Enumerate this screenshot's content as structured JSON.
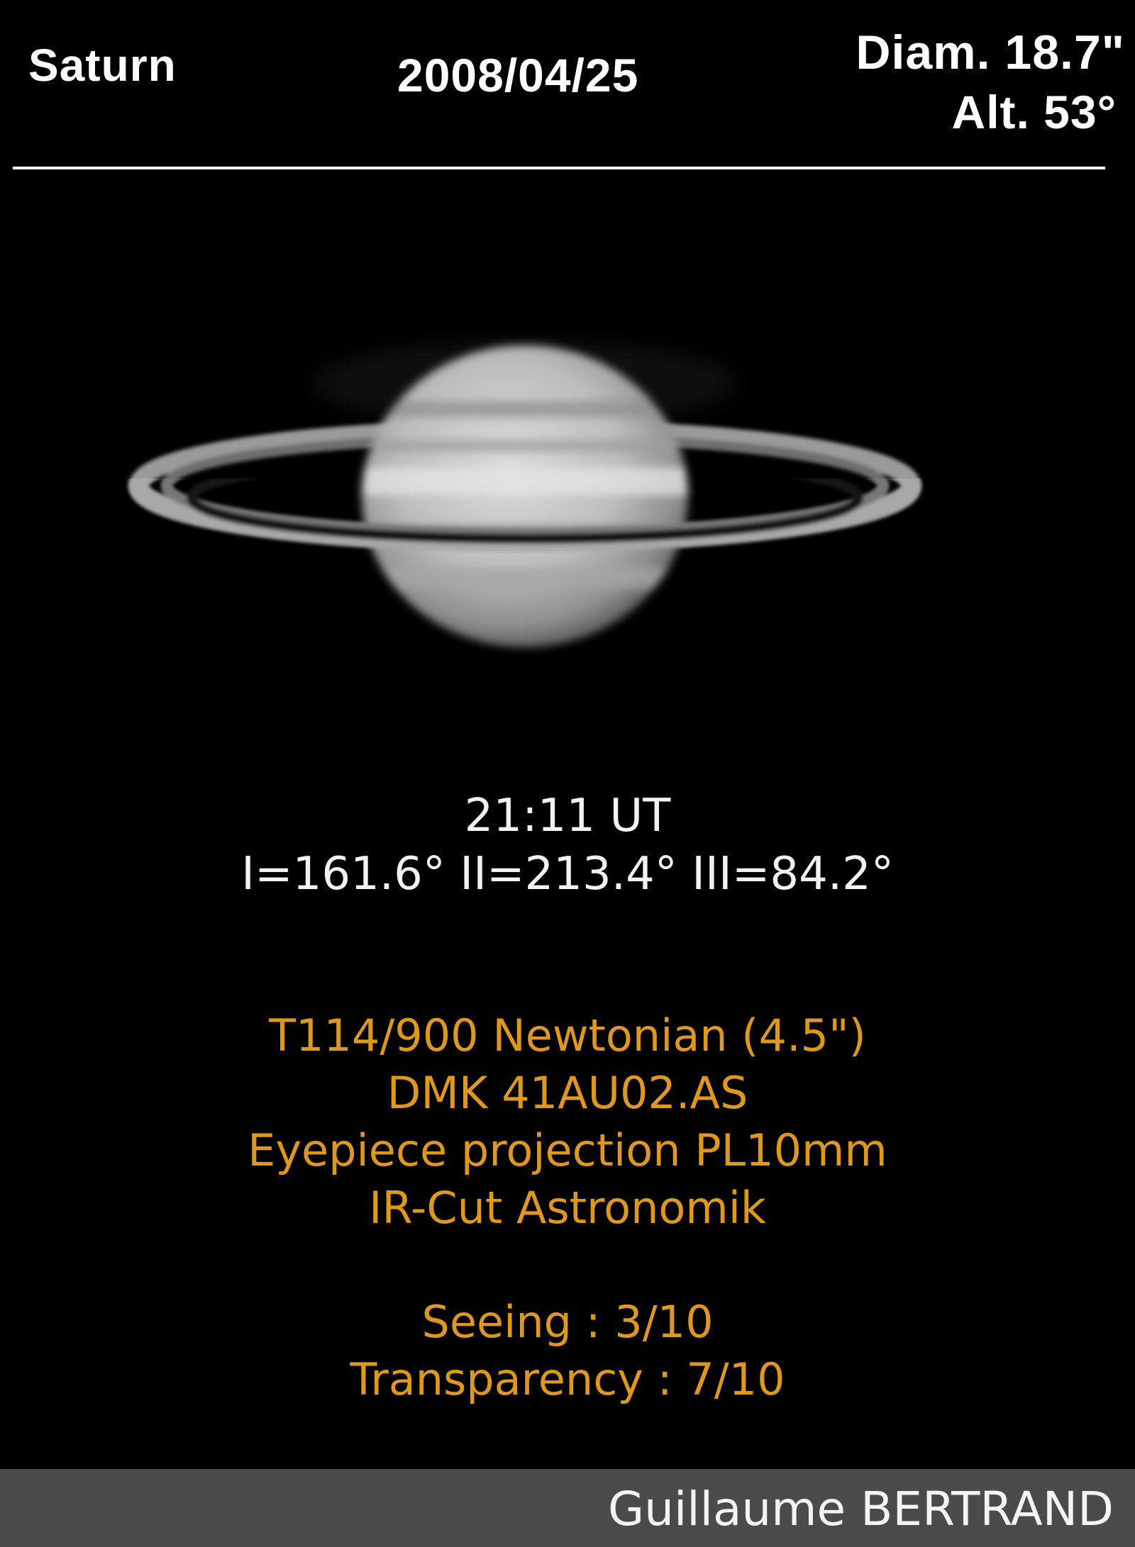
{
  "header": {
    "object": "Saturn",
    "date": "2008/04/25",
    "diameter": "Diam. 18.7\"",
    "altitude": "Alt. 53°"
  },
  "observation": {
    "time": "21:11 UT",
    "longitudes": "I=161.6° II=213.4° III=84.2°"
  },
  "equipment": {
    "telescope": "T114/900 Newtonian (4.5\")",
    "camera": "DMK 41AU02.AS",
    "optics": "Eyepiece projection PL10mm",
    "filter": "IR-Cut Astronomik"
  },
  "conditions": {
    "seeing": "Seeing : 3/10",
    "transparency": "Transparency : 7/10"
  },
  "credit": "Guillaume BERTRAND",
  "colors": {
    "background": "#000000",
    "info_text": "#e0981c",
    "footer_bar": "#4b4b4b"
  }
}
